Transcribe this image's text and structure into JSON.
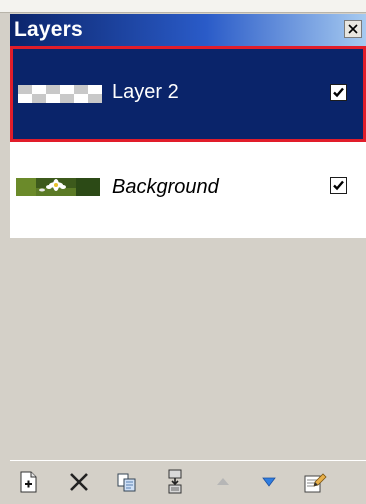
{
  "panel": {
    "title": "Layers",
    "close_icon": "close-icon"
  },
  "layers": [
    {
      "name": "Layer 2",
      "visible": true,
      "selected": true,
      "thumbnail": "transparent-checker"
    },
    {
      "name": "Background",
      "visible": true,
      "selected": false,
      "thumbnail": "daisy-photo"
    }
  ],
  "toolbar": {
    "buttons": [
      {
        "icon": "add-layer-icon"
      },
      {
        "icon": "delete-layer-icon"
      },
      {
        "icon": "duplicate-layer-icon"
      },
      {
        "icon": "merge-layer-down-icon"
      },
      {
        "icon": "move-layer-up-icon"
      },
      {
        "icon": "move-layer-down-icon"
      },
      {
        "icon": "layer-properties-icon"
      }
    ]
  },
  "colors": {
    "selection_background": "#0a246a",
    "selection_outline": "#e11d2a",
    "panel_background": "#d4d0c8"
  }
}
